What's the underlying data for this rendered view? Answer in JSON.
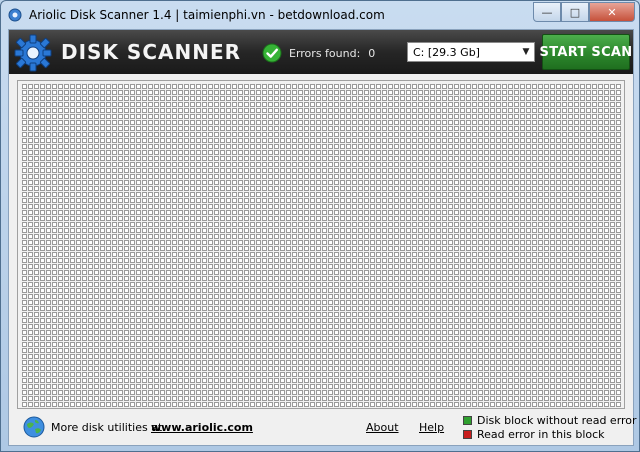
{
  "window": {
    "title": "Ariolic Disk Scanner 1.4 | taimienphi.vn - betdownload.com",
    "minimize_glyph": "—",
    "maximize_glyph": "□",
    "close_glyph": "✕"
  },
  "header": {
    "brand": "DISK SCANNER",
    "errors_label": "Errors found:",
    "errors_count": "0",
    "drive_value": "C:  [29.3 Gb]",
    "start_label": "START SCAN"
  },
  "colors": {
    "ok_block": "#2fa02f",
    "error_block": "#c81e1e",
    "start_button": "#2e8a2e",
    "header_bg": "#262626"
  },
  "footer": {
    "more_text": "More disk utilities at",
    "site_link": "www.ariolic.com",
    "about": "About",
    "help": "Help",
    "legend_ok": "Disk block without read error",
    "legend_err": "Read error in this block"
  }
}
